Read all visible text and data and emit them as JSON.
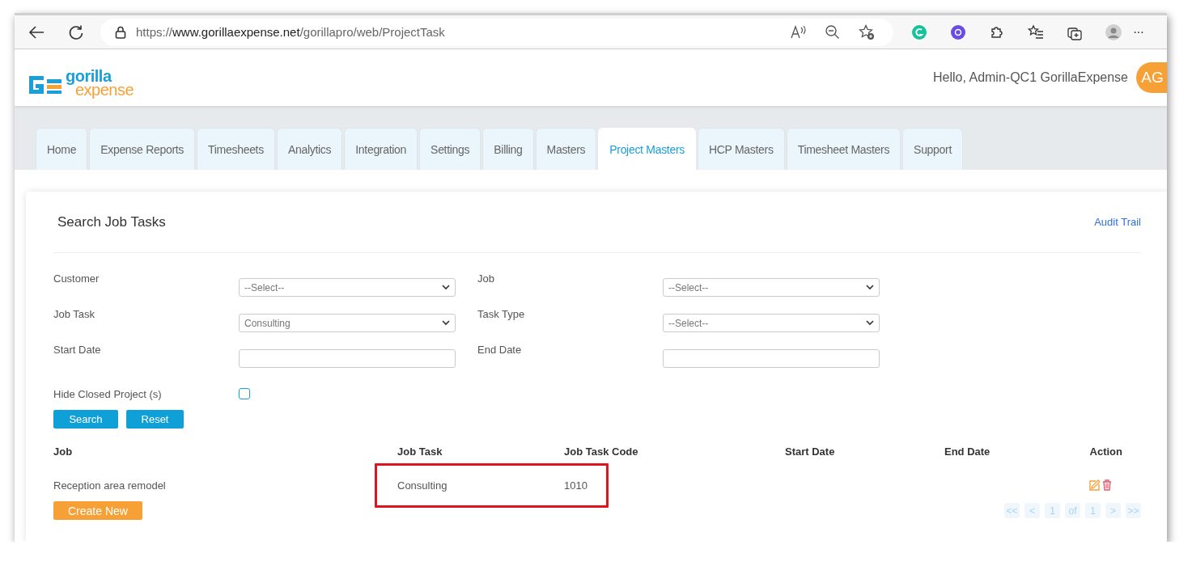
{
  "browser": {
    "url_scheme": "https://",
    "url_host": "www.gorillaexpense.net",
    "url_path": "/gorillapro/web/ProjectTask",
    "more": "···"
  },
  "header": {
    "logo_top": "gorilla",
    "logo_bottom": "expense",
    "greeting": "Hello, Admin-QC1 GorillaExpense",
    "avatar": "AG"
  },
  "tabs": [
    {
      "label": "Home",
      "selected": false
    },
    {
      "label": "Expense Reports",
      "selected": false
    },
    {
      "label": "Timesheets",
      "selected": false
    },
    {
      "label": "Analytics",
      "selected": false
    },
    {
      "label": "Integration",
      "selected": false
    },
    {
      "label": "Settings",
      "selected": false
    },
    {
      "label": "Billing",
      "selected": false
    },
    {
      "label": "Masters",
      "selected": false
    },
    {
      "label": "Project Masters",
      "selected": true
    },
    {
      "label": "HCP Masters",
      "selected": false
    },
    {
      "label": "Timesheet Masters",
      "selected": false
    },
    {
      "label": "Support",
      "selected": false
    }
  ],
  "search": {
    "title": "Search Job Tasks",
    "audit_link": "Audit Trail",
    "fields": [
      {
        "label": "Customer",
        "kind": "select",
        "value": "--Select--"
      },
      {
        "label": "Job",
        "kind": "select",
        "value": "--Select--"
      },
      {
        "label": "Job Task",
        "kind": "select",
        "value": "Consulting"
      },
      {
        "label": "Task Type",
        "kind": "select",
        "value": "--Select--"
      },
      {
        "label": "Start Date",
        "kind": "text"
      },
      {
        "label": "End Date",
        "kind": "text"
      }
    ],
    "hide_closed": {
      "label": "Hide Closed Project (s)",
      "checked": false
    },
    "buttons": [
      "Search",
      "Reset"
    ]
  },
  "table": {
    "columns": [
      "Job",
      "Job Task",
      "Job Task Code",
      "Start Date",
      "End Date",
      "Action"
    ],
    "rows": [
      {
        "job": "Reception area remodel",
        "job_task": "Consulting",
        "code": "1010",
        "start": "",
        "end": "",
        "highlighted": true
      }
    ]
  },
  "create_button": "Create New",
  "pagination": [
    "<<",
    "<",
    "1",
    "of",
    "1",
    ">",
    ">>"
  ]
}
